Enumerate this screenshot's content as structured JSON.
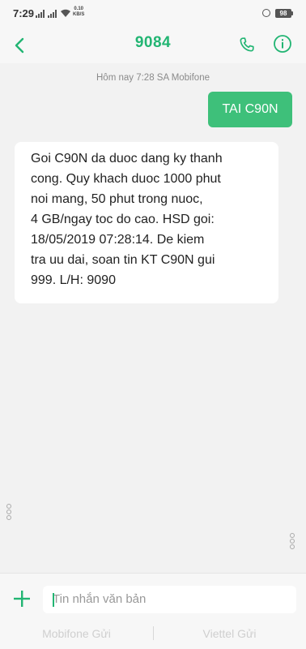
{
  "status_bar": {
    "time": "7:29",
    "net_speed_value": "0.10",
    "net_speed_unit": "KB/S",
    "battery": "98"
  },
  "header": {
    "title": "9084",
    "accent_color": "#22b573"
  },
  "conversation": {
    "timestamp": "Hôm nay 7:28 SA  Mobifone",
    "messages": [
      {
        "direction": "outgoing",
        "text": "TAI C90N"
      },
      {
        "direction": "incoming",
        "lines": [
          "Goi C90N da duoc dang ky thanh",
          "cong. Quy khach duoc 1000 phut",
          "noi mang, 50 phut trong nuoc,",
          "4 GB/ngay toc do cao. HSD goi:",
          "18/05/2019 07:28:14. De kiem",
          "tra uu dai, soan tin KT C90N gui",
          "999. L/H: 9090"
        ]
      }
    ]
  },
  "compose": {
    "placeholder": "Tin nhắn văn bản",
    "send_sim1": "Mobifone Gửi",
    "send_sim2": "Viettel Gửi"
  }
}
